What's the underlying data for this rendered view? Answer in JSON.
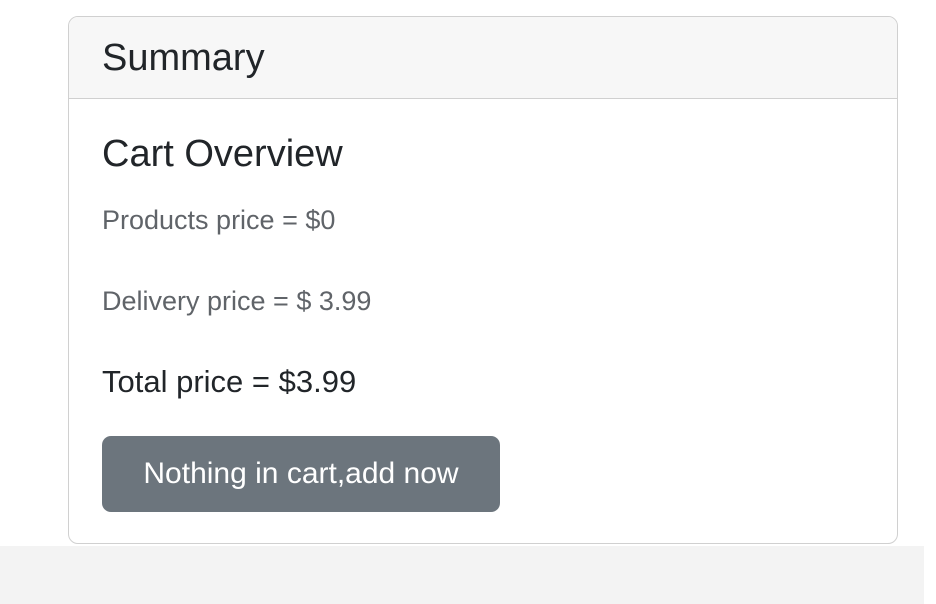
{
  "summary": {
    "header_title": "Summary",
    "card_title": "Cart Overview",
    "products_price": "Products price = $0",
    "delivery_price": "Delivery price = $ 3.99",
    "total_price": "Total price = $3.99",
    "cta_button_label": "Nothing in cart,add now"
  },
  "colors": {
    "card_header_bg": "#f7f7f7",
    "button_bg": "#6c757d",
    "button_text": "#ffffff",
    "muted_text": "#606469",
    "primary_text": "#212529"
  }
}
